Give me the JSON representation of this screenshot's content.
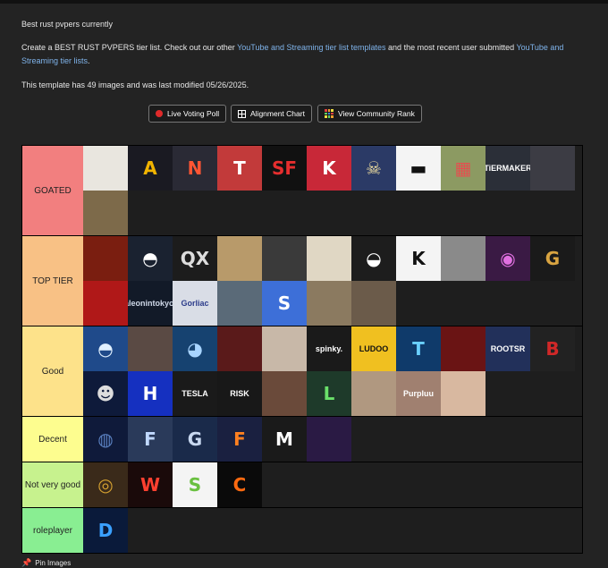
{
  "page": {
    "intro": "Best rust pvpers currently",
    "desc_pre": "Create a BEST RUST PVPERS tier list. Check out our other ",
    "desc_link1": "YouTube and Streaming tier list templates",
    "desc_mid": " and the most recent user submitted ",
    "desc_link2": "YouTube and Streaming tier lists",
    "desc_post": ".",
    "template_info": "This template has 49 images and was last modified 05/26/2025."
  },
  "buttons": {
    "live_voting": "Live Voting Poll",
    "alignment": "Alignment Chart",
    "community": "View Community Rank"
  },
  "tiers": [
    {
      "label": "GOATED",
      "color": "#f27f7f",
      "tiles": [
        {
          "icon": "polar-bear-avatar",
          "text": "",
          "bg": "#e9e6df",
          "fg": "#333"
        },
        {
          "icon": "letter-a-logo",
          "text": "A",
          "bg": "#1a1a22",
          "fg": "#f2b400"
        },
        {
          "icon": "n-logo",
          "text": "N",
          "bg": "#2a2a35",
          "fg": "#ff5533"
        },
        {
          "icon": "t-logo",
          "text": "T",
          "bg": "#c23a3a",
          "fg": "#ffffff"
        },
        {
          "icon": "sf-logo",
          "text": "SF",
          "bg": "#111111",
          "fg": "#e62e2e"
        },
        {
          "icon": "k-logo",
          "text": "K",
          "bg": "#c82838",
          "fg": "#ffffff"
        },
        {
          "icon": "skull-icon",
          "text": "☠",
          "bg": "#2b3a66",
          "fg": "#f0dfa0"
        },
        {
          "icon": "mask-icon",
          "text": "▬",
          "bg": "#f4f4f4",
          "fg": "#111111"
        },
        {
          "icon": "pixel-avatar",
          "text": "▦",
          "bg": "#8c9a62",
          "fg": "#e35050"
        },
        {
          "icon": "tiermaker-logo",
          "text": "TiERMAKER",
          "bg": "#2b2f38",
          "fg": "#ffffff"
        },
        {
          "icon": "screenshot-thumb",
          "text": "",
          "bg": "#3c3c44",
          "fg": "#aaaaaa"
        },
        {
          "icon": "face-avatar",
          "text": "",
          "bg": "#7d6a4a",
          "fg": "#ffffff"
        }
      ]
    },
    {
      "label": "TOP TIER",
      "color": "#f8c185",
      "tiles": [
        {
          "icon": "red-scene",
          "text": "",
          "bg": "#7a1e10",
          "fg": "#ffaa55"
        },
        {
          "icon": "hood-avatar",
          "text": "◓",
          "bg": "#1a2230",
          "fg": "#ffffff"
        },
        {
          "icon": "qx-logo",
          "text": "QX",
          "bg": "#1c1c1c",
          "fg": "#dddddd"
        },
        {
          "icon": "puppy-photo",
          "text": "",
          "bg": "#b89a6a",
          "fg": "#ffffff"
        },
        {
          "icon": "mask-photo",
          "text": "",
          "bg": "#3a3a3a",
          "fg": "#ffffff"
        },
        {
          "icon": "cartoon-avatar",
          "text": "",
          "bg": "#e0d7c4",
          "fg": "#333"
        },
        {
          "icon": "bird-logo",
          "text": "◒",
          "bg": "#1d1d1d",
          "fg": "#ffffff"
        },
        {
          "icon": "k-script-logo",
          "text": "K",
          "bg": "#f4f4f4",
          "fg": "#111111"
        },
        {
          "icon": "astronaut-photo",
          "text": "",
          "bg": "#8a8a8a",
          "fg": "#ffffff"
        },
        {
          "icon": "eye-graphic",
          "text": "◉",
          "bg": "#3a1a44",
          "fg": "#e070e0"
        },
        {
          "icon": "g-logo",
          "text": "G",
          "bg": "#1a1a1a",
          "fg": "#d9a441"
        },
        {
          "icon": "red-face",
          "text": "",
          "bg": "#b01818",
          "fg": "#000000"
        },
        {
          "icon": "text-banner",
          "text": "aleonintokyo.",
          "bg": "#121a28",
          "fg": "#cfd8e8"
        },
        {
          "icon": "gorliac-logo",
          "text": "Gorliac",
          "bg": "#d9dde6",
          "fg": "#2c3c8a"
        },
        {
          "icon": "soldier-avatar",
          "text": "",
          "bg": "#5a6a78",
          "fg": "#ffffff"
        },
        {
          "icon": "s-logo",
          "text": "S",
          "bg": "#3d6fd8",
          "fg": "#ffffff"
        },
        {
          "icon": "cat-photo",
          "text": "",
          "bg": "#8b7a60",
          "fg": "#ffffff"
        },
        {
          "icon": "doll-face",
          "text": "",
          "bg": "#6b5b4a",
          "fg": "#ffffff"
        }
      ]
    },
    {
      "label": "Good",
      "color": "#fde28a",
      "tiles": [
        {
          "icon": "hood-logo",
          "text": "◓",
          "bg": "#1f4a8a",
          "fg": "#e0f0ff"
        },
        {
          "icon": "hat-photo",
          "text": "",
          "bg": "#5a4a44",
          "fg": "#ffffff"
        },
        {
          "icon": "bear-logo",
          "text": "◕",
          "bg": "#164270",
          "fg": "#a8d4ff"
        },
        {
          "icon": "rider-photo",
          "text": "",
          "bg": "#5a1a1a",
          "fg": "#ffffff"
        },
        {
          "icon": "boy-photo",
          "text": "",
          "bg": "#c8b8a8",
          "fg": "#333"
        },
        {
          "icon": "spinky-logo",
          "text": "spinky.",
          "bg": "#1a1a1a",
          "fg": "#ffffff"
        },
        {
          "icon": "ludoo-logo",
          "text": "LUDOO",
          "bg": "#f0c020",
          "fg": "#111111"
        },
        {
          "icon": "t-circle-logo",
          "text": "T",
          "bg": "#0f3a6a",
          "fg": "#6ad0ff"
        },
        {
          "icon": "red-effect",
          "text": "",
          "bg": "#6a1414",
          "fg": "#ffffff"
        },
        {
          "icon": "rootsr-avatar",
          "text": "ROOTSR",
          "bg": "#22305a",
          "fg": "#ffffff"
        },
        {
          "icon": "b-logo",
          "text": "B",
          "bg": "#222222",
          "fg": "#d02828"
        },
        {
          "icon": "grin-mask",
          "text": "☻",
          "bg": "#0e1a3a",
          "fg": "#dddddd"
        },
        {
          "icon": "h-logo",
          "text": "H",
          "bg": "#1530c0",
          "fg": "#ffffff"
        },
        {
          "icon": "tesla-avatar",
          "text": "TESLA",
          "bg": "#1a1a1a",
          "fg": "#ffffff"
        },
        {
          "icon": "risk-logo",
          "text": "RISK",
          "bg": "#181818",
          "fg": "#ffffff"
        },
        {
          "icon": "man-photo",
          "text": "",
          "bg": "#6a4a3a",
          "fg": "#ffffff"
        },
        {
          "icon": "l-logo",
          "text": "L",
          "bg": "#1e3a2a",
          "fg": "#6ae06a"
        },
        {
          "icon": "glasses-photo",
          "text": "",
          "bg": "#b09880",
          "fg": "#ffffff"
        },
        {
          "icon": "purpluu-photo",
          "text": "Purpluu",
          "bg": "#a08070",
          "fg": "#ffffff"
        },
        {
          "icon": "boy-portrait",
          "text": "",
          "bg": "#d8b8a0",
          "fg": "#ffffff"
        }
      ]
    },
    {
      "label": "Decent",
      "color": "#fdfd8f",
      "tiles": [
        {
          "icon": "dark-logo",
          "text": "◍",
          "bg": "#0f1a3a",
          "fg": "#5a80c0"
        },
        {
          "icon": "f-logo",
          "text": "F",
          "bg": "#2a3a5a",
          "fg": "#c0d8ff"
        },
        {
          "icon": "g-block-logo",
          "text": "G",
          "bg": "#1a2a4a",
          "fg": "#c8d8f0"
        },
        {
          "icon": "f-circle-logo",
          "text": "F",
          "bg": "#1a2040",
          "fg": "#ff8020"
        },
        {
          "icon": "m-logo",
          "text": "M",
          "bg": "#1a1a1a",
          "fg": "#ffffff"
        },
        {
          "icon": "purple-banner",
          "text": "",
          "bg": "#2a1a44",
          "fg": "#ffffff"
        }
      ]
    },
    {
      "label": "Not very good",
      "color": "#c7f28e",
      "tiles": [
        {
          "icon": "laurel-badge",
          "text": "◎",
          "bg": "#3a2a1a",
          "fg": "#d4a030"
        },
        {
          "icon": "neon-w-logo",
          "text": "W",
          "bg": "#1a0a0a",
          "fg": "#ff4030"
        },
        {
          "icon": "s-arrow-logo",
          "text": "S",
          "bg": "#f4f4f4",
          "fg": "#6ac040"
        },
        {
          "icon": "c-logo",
          "text": "C",
          "bg": "#0a0a0a",
          "fg": "#ff6a10"
        }
      ]
    },
    {
      "label": "roleplayer",
      "color": "#89ee92",
      "tiles": [
        {
          "icon": "d-logo",
          "text": "D",
          "bg": "#0a1a3a",
          "fg": "#3aa0ff"
        }
      ]
    }
  ],
  "footer": {
    "pin_label": "Pin Images"
  }
}
